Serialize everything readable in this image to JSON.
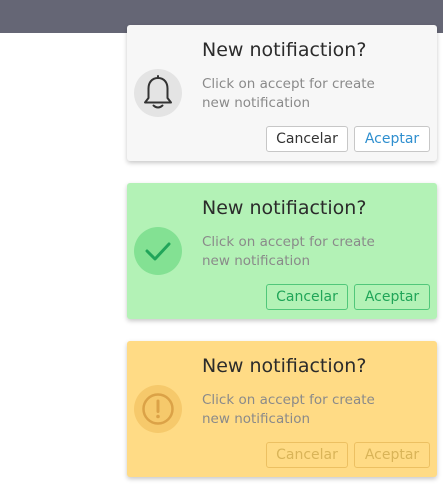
{
  "colors": {
    "topbar": "#656675",
    "default_bg": "#f7f7f7",
    "success_bg": "#b3f2b6",
    "warning_bg": "#ffdb85",
    "accept_link": "#2f8fcf",
    "success_text": "#20a558"
  },
  "notifications": [
    {
      "variant": "default",
      "icon": "bell-icon",
      "title": "New notifiaction?",
      "message": "Click on accept for create new notification",
      "cancel_label": "Cancelar",
      "accept_label": "Aceptar"
    },
    {
      "variant": "success",
      "icon": "check-icon",
      "title": "New notifiaction?",
      "message": "Click on accept for create new notification",
      "cancel_label": "Cancelar",
      "accept_label": "Aceptar"
    },
    {
      "variant": "warning",
      "icon": "exclamation-circle-icon",
      "title": "New notifiaction?",
      "message": "Click on accept for create new notification",
      "cancel_label": "Cancelar",
      "accept_label": "Aceptar"
    }
  ]
}
